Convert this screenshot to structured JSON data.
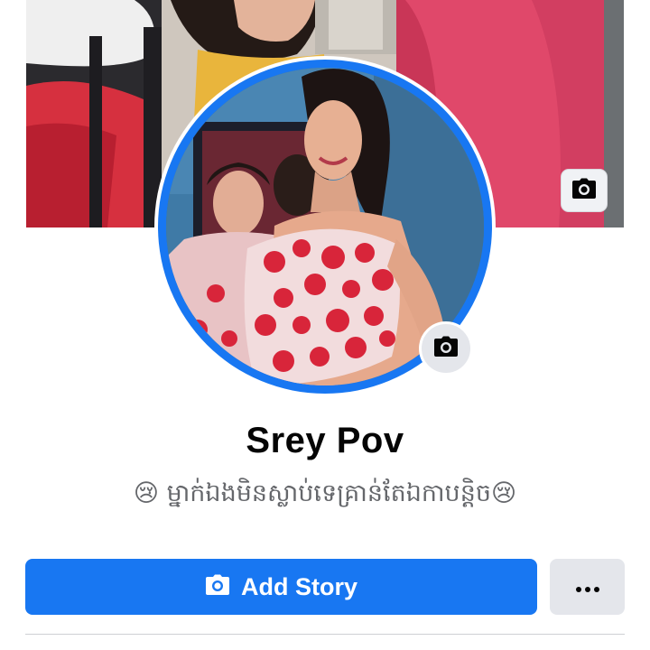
{
  "profile": {
    "name": "Srey Pov",
    "bio": "😢 ម្នាក់ឯងមិនស្លាប់ទេគ្រាន់តែឯកាបន្តិច😢"
  },
  "cover": {
    "camera_icon": "camera-icon"
  },
  "avatar": {
    "camera_icon": "camera-icon"
  },
  "actions": {
    "add_story_label": "Add Story",
    "add_story_icon": "camera-icon",
    "more_icon": "more-horizontal-icon"
  },
  "colors": {
    "accent": "#1877f2",
    "secondary_button": "#e4e6eb",
    "name_text": "#050505",
    "bio_text": "#65676b"
  }
}
